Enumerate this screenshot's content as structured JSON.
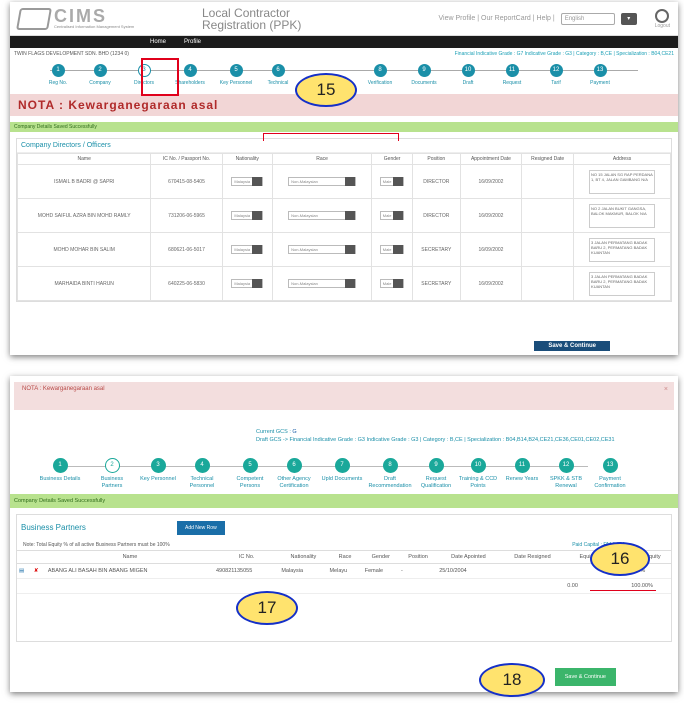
{
  "header": {
    "logo_text": "CIMS",
    "logo_sub": "Centralised Information Management System",
    "title_line1": "Local Contractor",
    "title_line2": "Registration (PPK)",
    "links": "View Profile | Our ReportCard | Help |",
    "language": "English",
    "logout": "Logout"
  },
  "menu": [
    "Home",
    "Profile"
  ],
  "company_bar": {
    "name": "TWIN FLAGS DEVELOPMENT SDN. BHD (1234 0)",
    "grades": "Financial Indicative Grade : G7  Indicative Grade : G3 | Category : B,CE | Specialization : B04,CE21"
  },
  "steps1": [
    {
      "num": "1",
      "label": "Reg No."
    },
    {
      "num": "2",
      "label": "Company"
    },
    {
      "num": "3",
      "label": "Directors"
    },
    {
      "num": "4",
      "label": "Shareholders"
    },
    {
      "num": "5",
      "label": "Key Personnel"
    },
    {
      "num": "6",
      "label": "Technical"
    },
    {
      "num": "8",
      "label": "Verification"
    },
    {
      "num": "9",
      "label": "Documents"
    },
    {
      "num": "10",
      "label": "Draft"
    },
    {
      "num": "11",
      "label": "Request"
    },
    {
      "num": "12",
      "label": "Tarif"
    },
    {
      "num": "13",
      "label": "Payment"
    }
  ],
  "nota1": "NOTA : Kewarganegaraan asal",
  "saved_msg": "Company Details Saved Successfully",
  "directors": {
    "title": "Company Directors / Officers",
    "headers": [
      "Name",
      "IC No. / Passport No.",
      "Nationality",
      "Race",
      "Gender",
      "Position",
      "Appointment Date",
      "Resigned Date",
      "Address"
    ],
    "rows": [
      {
        "name": "ISMAIL B BADRI @ SAPRI",
        "ic": "670415-08-5405",
        "nat": "Malaysia",
        "race": "Non-Malaysian",
        "gender": "Male",
        "pos": "DIRECTOR",
        "appt": "16/09/2002",
        "addr": "NO 15 JALAN SG RAP PERDANA 1, BT 4, JALAN GAMBANG N/A"
      },
      {
        "name": "MOHD SAIFUL AZRA BIN MOHD RAMLY",
        "ic": "731206-06-5965",
        "nat": "Malaysia",
        "race": "Non-Malaysian",
        "gender": "Male",
        "pos": "DIRECTOR",
        "appt": "16/09/2002",
        "addr": "NO 2 JALAN BUKIT GANGSA, BALOK MAKMUR, BALOK N/A"
      },
      {
        "name": "MOHD MOHAR BIN SALIM",
        "ic": "680621-06-5017",
        "nat": "Malaysia",
        "race": "Non-Malaysian",
        "gender": "Male",
        "pos": "SECRETARY",
        "appt": "16/09/2002",
        "addr": "3 JALAN PERMATANG BADAK BARU 2, PERMATANG BADAK KUANTAN"
      },
      {
        "name": "MARHAIDA BINTI HARUN",
        "ic": "640225-06-5830",
        "nat": "Malaysia",
        "race": "Non-Malaysian",
        "gender": "Male",
        "pos": "SECRETARY",
        "appt": "16/09/2002",
        "addr": "3 JALAN PERMATANG BADAK BARU 2, PERMATANG BADAK KUANTAN"
      }
    ]
  },
  "save_continue": "Save & Continue",
  "callouts": {
    "c15": "15",
    "c16": "16",
    "c17": "17",
    "c18": "18"
  },
  "nota2": "NOTA : Kewarganegaraan asal",
  "nota2_close": "×",
  "info2": {
    "line1": "Current GCS :",
    "line1_val": "G",
    "line2": "Draft GCS -> Financial Indicative Grade : G3  Indicative Grade : G3 | Category : B,CE | Specialization : B04,B14,B24,CE21,CE36,CE01,CE02,CE31"
  },
  "steps2": [
    {
      "num": "1",
      "label": "Business Details"
    },
    {
      "num": "2",
      "label": "Business Partners"
    },
    {
      "num": "3",
      "label": "Key Personnel"
    },
    {
      "num": "4",
      "label": "Technical Personnel"
    },
    {
      "num": "5",
      "label": "Competent Persons"
    },
    {
      "num": "6",
      "label": "Other Agency Certification"
    },
    {
      "num": "7",
      "label": "Upld Documents"
    },
    {
      "num": "8",
      "label": "Draft Recommendation"
    },
    {
      "num": "9",
      "label": "Request Qualification"
    },
    {
      "num": "10",
      "label": "Training & CCD Points"
    },
    {
      "num": "11",
      "label": "Renew Years"
    },
    {
      "num": "12",
      "label": "SPKK & STB Renewal"
    },
    {
      "num": "13",
      "label": "Payment Confirmation"
    }
  ],
  "partners": {
    "title": "Business Partners",
    "add_row": "Add New Row",
    "note": "Note: Total Equity % of all active Business Partners must be 100%",
    "paid_capital": "Paid Capital : RM 1,000",
    "headers": [
      "",
      "",
      "Name",
      "IC No.",
      "Nationality",
      "Race",
      "Gender",
      "Position",
      "Date Apointed",
      "Date Resigned",
      "Equity Amount",
      "% equity"
    ],
    "row": {
      "name": "ABANG ALI BASAH BIN ABANG MIGEN",
      "ic": "490821135055",
      "nat": "Malaysia",
      "race": "Melayu",
      "gender": "Female",
      "pos": "-",
      "appt": "25/10/2004",
      "resigned": "",
      "amount": "",
      "pct": "100%"
    },
    "totals": {
      "amount": "0.00",
      "pct": "100.00%"
    }
  },
  "save_continue2": "Save & Continue"
}
